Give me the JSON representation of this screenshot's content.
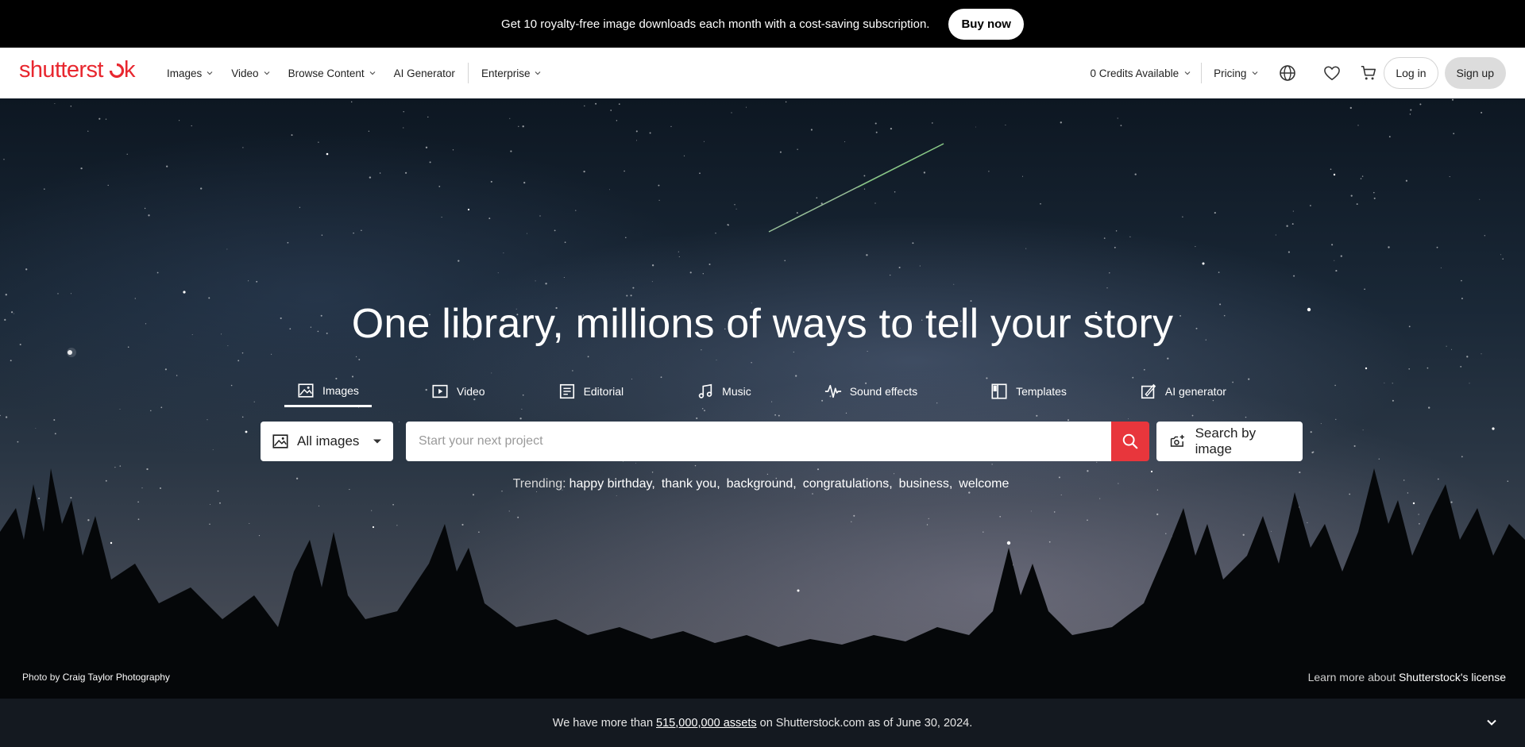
{
  "promo": {
    "text": "Get 10 royalty-free image downloads each month with a cost-saving subscription.",
    "button": "Buy now"
  },
  "header": {
    "logo": "shutterstck",
    "nav": [
      {
        "label": "Images",
        "has_dropdown": true
      },
      {
        "label": "Video",
        "has_dropdown": true
      },
      {
        "label": "Browse Content",
        "has_dropdown": true
      },
      {
        "label": "AI Generator",
        "has_dropdown": false
      },
      {
        "label": "Enterprise",
        "has_dropdown": true
      }
    ],
    "credits": "0 Credits Available",
    "pricing": "Pricing",
    "login": "Log in",
    "signup": "Sign up",
    "icons": [
      "globe-icon",
      "heart-icon",
      "cart-icon"
    ]
  },
  "hero": {
    "headline": "One library, millions of ways to tell your story",
    "tabs": [
      {
        "label": "Images",
        "icon": "image-icon",
        "active": true
      },
      {
        "label": "Video",
        "icon": "video-icon",
        "active": false
      },
      {
        "label": "Editorial",
        "icon": "editorial-icon",
        "active": false
      },
      {
        "label": "Music",
        "icon": "music-icon",
        "active": false
      },
      {
        "label": "Sound effects",
        "icon": "sound-wave-icon",
        "active": false
      },
      {
        "label": "Templates",
        "icon": "templates-icon",
        "active": false
      },
      {
        "label": "AI generator",
        "icon": "ai-generator-icon",
        "active": false
      }
    ],
    "scope": "All images",
    "search_placeholder": "Start your next project",
    "search_by_image": "Search by image",
    "trending_label": "Trending:",
    "trending": [
      "happy birthday,",
      "thank you,",
      "background,",
      "congratulations,",
      "business,",
      "welcome"
    ],
    "photo_prefix": "Photo",
    "photo_by": "by",
    "photographer": "Craig Taylor Photography",
    "license_prefix": "Learn more about",
    "license_link": "Shutterstock's license"
  },
  "footer_bar": {
    "text_before": "We have more than",
    "assets": "515,000,000 assets",
    "text_after": "on Shutterstock.com as of June 30, 2024."
  },
  "colors": {
    "brand_red": "#e8272f",
    "search_button": "#e8363c",
    "bottom_bar": "#141920"
  }
}
